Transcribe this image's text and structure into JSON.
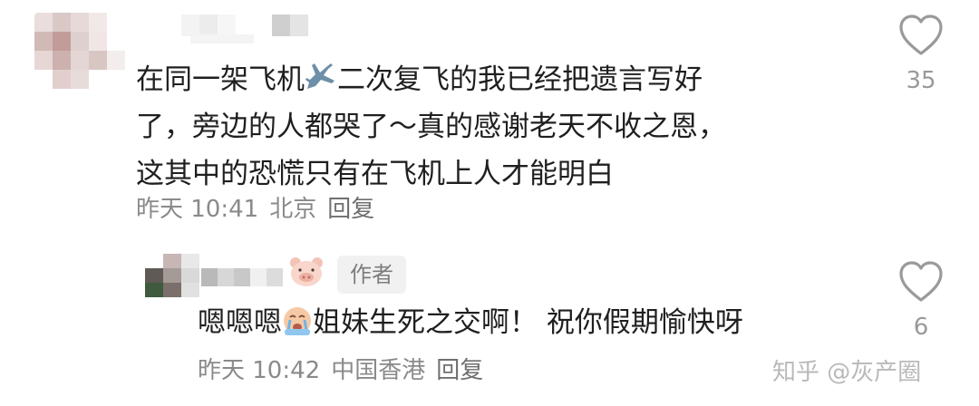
{
  "comment": {
    "lines": [
      [
        "在同一架飞机",
        "二次复飞的我已经把遗言写好"
      ],
      "了，旁边的人都哭了～真的感谢老天不收之恩，",
      "这其中的恐慌只有在飞机上人才能明白"
    ],
    "time": "昨天 10:41",
    "location": "北京",
    "reply_label": "回复",
    "likes": "35",
    "icons": {
      "inline_emoji": "airplane-emoji",
      "like": "heart-outline-icon"
    }
  },
  "reply": {
    "badge": "作者",
    "text_before": "嗯嗯嗯",
    "text_after": "姐妹生死之交啊！ 祝你假期愉快呀",
    "time": "昨天 10:42",
    "location": "中国香港",
    "reply_label": "回复",
    "likes": "6",
    "icons": {
      "inline_emoji": "crying-face-emoji",
      "name_emoji": "pig-face-emoji",
      "like": "heart-outline-icon"
    }
  },
  "watermark": "知乎 @灰产圈",
  "colors": {
    "text": "#1f1f1f",
    "meta": "#8a8a8a",
    "badge_bg": "#f1f1f1"
  }
}
